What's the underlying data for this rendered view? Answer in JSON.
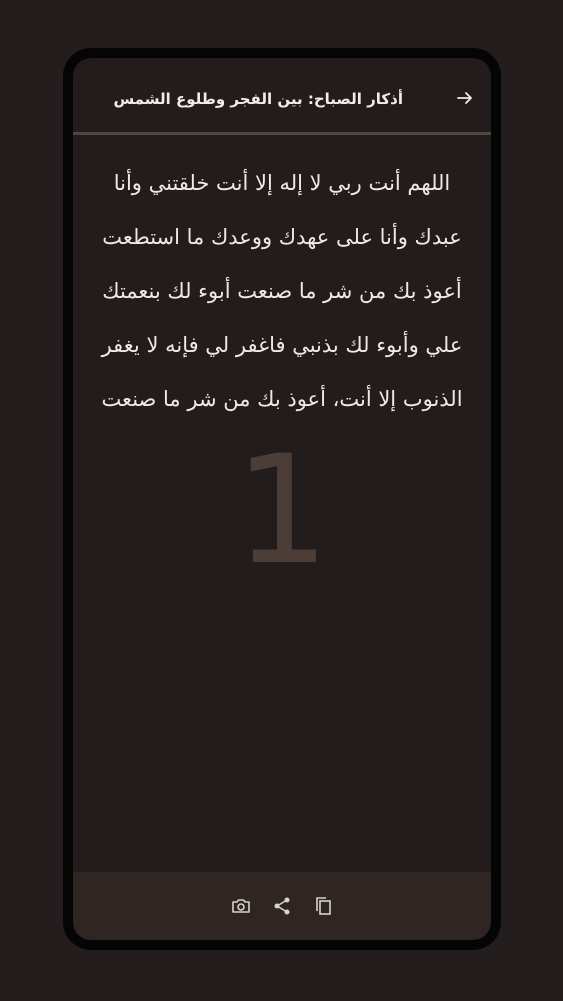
{
  "header": {
    "title": "أذكار الصباح: بين الفجر وطلوع الشمس",
    "back_icon": "arrow-back-icon"
  },
  "dhikr": {
    "text": "اللهم أنت ربي لا إله إلا أنت خلقتني وأنا عبدك وأنا على عهدك ووعدك ما استطعت أعوذ بك من شر ما صنعت أبوء لك بنعمتك علي وأبوء لك بذنبي فاغفر لي فإنه لا يغفر الذنوب إلا أنت، أعوذ بك من شر ما صنعت"
  },
  "counter": {
    "value": "1"
  },
  "actions": [
    {
      "icon": "camera-icon"
    },
    {
      "icon": "share-icon"
    },
    {
      "icon": "copy-icon"
    }
  ],
  "colors": {
    "background": "#231e1d",
    "screen": "#221d1c",
    "text": "#efe9e6",
    "counter": "#4d3d37",
    "bottom_bar": "#2f2522",
    "divider": "#4e4641"
  }
}
